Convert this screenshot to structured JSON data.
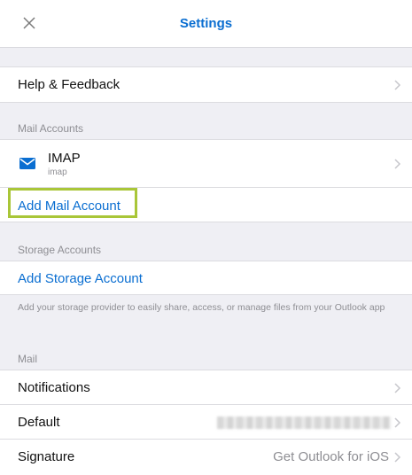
{
  "header": {
    "title": "Settings",
    "close_icon": "close-icon"
  },
  "help": {
    "label": "Help & Feedback"
  },
  "mail_accounts": {
    "section_label": "Mail Accounts",
    "account": {
      "name": "IMAP",
      "type": "imap",
      "icon": "mail-icon"
    },
    "add_label": "Add Mail Account"
  },
  "storage_accounts": {
    "section_label": "Storage Accounts",
    "add_label": "Add Storage Account",
    "info": "Add your storage provider to easily share, access, or manage files from your Outlook app"
  },
  "mail": {
    "section_label": "Mail",
    "notifications_label": "Notifications",
    "default_label": "Default",
    "signature_label": "Signature",
    "signature_value": "Get Outlook for iOS"
  },
  "colors": {
    "accent": "#0a6ed1",
    "highlight": "#a9c638",
    "background": "#efeff4"
  }
}
